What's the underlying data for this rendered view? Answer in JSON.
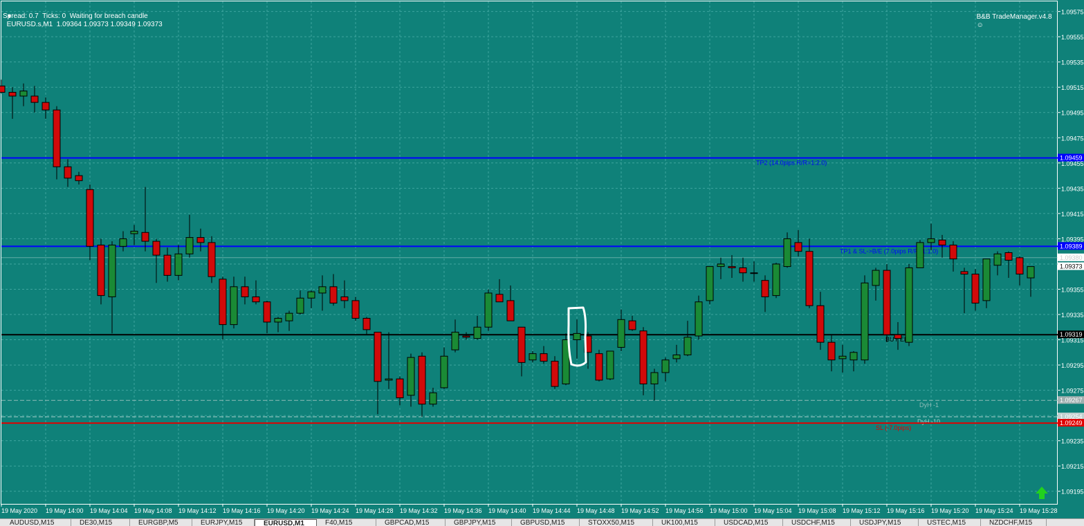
{
  "header": {
    "symbol_line": "EURUSD.s,M1  1.09364 1.09373 1.09349 1.09373",
    "status_line": "Spread: 0.7  Ticks: 0  Waiting for breach candle",
    "manager_label": "B&B TradeManager.v4.8"
  },
  "colors": {
    "background": "#0f8179",
    "grid": "#3fa59e",
    "bull": "#1a8a35",
    "bear": "#d10a0a",
    "tp_line": "#0000ff",
    "entry_line": "#000000",
    "sl_line": "#e00000",
    "text": "#ffffff"
  },
  "price_axis": {
    "ticks": [
      "1.09575",
      "1.09555",
      "1.09535",
      "1.09515",
      "1.09495",
      "1.09475",
      "1.09455",
      "1.09435",
      "1.09415",
      "1.09395",
      "1.09375",
      "1.09355",
      "1.09335",
      "1.09315",
      "1.09295",
      "1.09275",
      "1.09255",
      "1.09235",
      "1.09215",
      "1.09195"
    ],
    "labels": [
      {
        "text": "1.09459",
        "price": 1.09459,
        "color": "#0000ff",
        "fg": "#ffffff"
      },
      {
        "text": "1.09389",
        "price": 1.09389,
        "color": "#0000ff",
        "fg": "#ffffff"
      },
      {
        "text": "1.09380",
        "price": 1.0938,
        "color": "#ffffff",
        "fg": "#cccccc"
      },
      {
        "text": "1.09373",
        "price": 1.09373,
        "color": "#ffffff",
        "fg": "#000000"
      },
      {
        "text": "1.09319",
        "price": 1.09319,
        "color": "#000000",
        "fg": "#ffffff"
      },
      {
        "text": "1.09267",
        "price": 1.09267,
        "color": "#a0b0b0",
        "fg": "#ffffff"
      },
      {
        "text": "1.09254",
        "price": 1.09254,
        "color": "#c0d0d0",
        "fg": "#ffffff"
      },
      {
        "text": "1.09249",
        "price": 1.09249,
        "color": "#e00000",
        "fg": "#ffffff"
      }
    ]
  },
  "time_axis": {
    "labels": [
      "19 May 2020",
      "19 May 14:00",
      "19 May 14:04",
      "19 May 14:08",
      "19 May 14:12",
      "19 May 14:16",
      "19 May 14:20",
      "19 May 14:24",
      "19 May 14:28",
      "19 May 14:32",
      "19 May 14:36",
      "19 May 14:40",
      "19 May 14:44",
      "19 May 14:48",
      "19 May 14:52",
      "19 May 14:56",
      "19 May 15:00",
      "19 May 15:04",
      "19 May 15:08",
      "19 May 15:12",
      "19 May 15:16",
      "19 May 15:20",
      "19 May 15:24",
      "19 May 15:28"
    ]
  },
  "levels": [
    {
      "name": "tp2-line",
      "price": 1.09459,
      "color": "#0000ff",
      "label": "TP2 (14.0pips R/R=1:2.0)",
      "label_x": 1093,
      "dash": false,
      "width": 2
    },
    {
      "name": "tp1-line",
      "price": 1.09389,
      "color": "#0000ff",
      "label": "TP1 & SL->B/E (7.0pips R/R=1:1.0)",
      "label_x": 1214,
      "dash": false,
      "width": 2
    },
    {
      "name": "entry-line",
      "price": 1.09319,
      "color": "#000000",
      "label": "BUY EP",
      "label_x": 1280,
      "dash": false,
      "width": 2
    },
    {
      "name": "dyh1-line",
      "price": 1.09267,
      "color": "#8fbcb8",
      "label": "DyH -1",
      "label_x": 1329,
      "dash": true,
      "width": 1
    },
    {
      "name": "dyh10-line",
      "price": 1.09254,
      "color": "#a8cfcb",
      "label": "DyH -10",
      "label_x": 1326,
      "dash": true,
      "width": 1
    },
    {
      "name": "sl-line",
      "price": 1.09249,
      "color": "#e00000",
      "label": "SL (-7.0pips)",
      "label_x": 1266,
      "dash": false,
      "width": 2
    }
  ],
  "chart_data": {
    "type": "candlestick",
    "symbol": "EURUSD.s",
    "timeframe": "M1",
    "ylim": [
      1.09185,
      1.09583
    ],
    "candles": [
      {
        "o": 1.09516,
        "h": 1.09521,
        "l": 1.0951,
        "c": 1.09511
      },
      {
        "o": 1.09511,
        "h": 1.09515,
        "l": 1.0949,
        "c": 1.09508
      },
      {
        "o": 1.09508,
        "h": 1.09518,
        "l": 1.095,
        "c": 1.09512
      },
      {
        "o": 1.09508,
        "h": 1.09516,
        "l": 1.09495,
        "c": 1.09503
      },
      {
        "o": 1.09503,
        "h": 1.09507,
        "l": 1.0949,
        "c": 1.09497
      },
      {
        "o": 1.09497,
        "h": 1.095,
        "l": 1.09442,
        "c": 1.09452
      },
      {
        "o": 1.09452,
        "h": 1.09458,
        "l": 1.09436,
        "c": 1.09443
      },
      {
        "o": 1.09445,
        "h": 1.09448,
        "l": 1.09438,
        "c": 1.09441
      },
      {
        "o": 1.09434,
        "h": 1.09438,
        "l": 1.09378,
        "c": 1.09389
      },
      {
        "o": 1.0939,
        "h": 1.09395,
        "l": 1.09343,
        "c": 1.0935
      },
      {
        "o": 1.09349,
        "h": 1.09393,
        "l": 1.0932,
        "c": 1.0939
      },
      {
        "o": 1.09389,
        "h": 1.09401,
        "l": 1.09385,
        "c": 1.09395
      },
      {
        "o": 1.09399,
        "h": 1.09406,
        "l": 1.0939,
        "c": 1.09401
      },
      {
        "o": 1.094,
        "h": 1.09436,
        "l": 1.09385,
        "c": 1.09393
      },
      {
        "o": 1.09393,
        "h": 1.09395,
        "l": 1.0936,
        "c": 1.09382
      },
      {
        "o": 1.09382,
        "h": 1.09388,
        "l": 1.09361,
        "c": 1.09366
      },
      {
        "o": 1.09366,
        "h": 1.0939,
        "l": 1.09362,
        "c": 1.09383
      },
      {
        "o": 1.09383,
        "h": 1.09414,
        "l": 1.0938,
        "c": 1.09396
      },
      {
        "o": 1.09396,
        "h": 1.09403,
        "l": 1.09385,
        "c": 1.09392
      },
      {
        "o": 1.09392,
        "h": 1.09397,
        "l": 1.0936,
        "c": 1.09365
      },
      {
        "o": 1.09363,
        "h": 1.09365,
        "l": 1.09315,
        "c": 1.09327
      },
      {
        "o": 1.09327,
        "h": 1.09365,
        "l": 1.09324,
        "c": 1.09357
      },
      {
        "o": 1.09357,
        "h": 1.09365,
        "l": 1.09343,
        "c": 1.09349
      },
      {
        "o": 1.09349,
        "h": 1.09362,
        "l": 1.09343,
        "c": 1.09345
      },
      {
        "o": 1.09345,
        "h": 1.09346,
        "l": 1.0932,
        "c": 1.09329
      },
      {
        "o": 1.09329,
        "h": 1.09333,
        "l": 1.09321,
        "c": 1.09332
      },
      {
        "o": 1.0933,
        "h": 1.09338,
        "l": 1.09322,
        "c": 1.09336
      },
      {
        "o": 1.09336,
        "h": 1.09354,
        "l": 1.09335,
        "c": 1.09348
      },
      {
        "o": 1.09348,
        "h": 1.09354,
        "l": 1.0934,
        "c": 1.09353
      },
      {
        "o": 1.09352,
        "h": 1.09366,
        "l": 1.09338,
        "c": 1.09357
      },
      {
        "o": 1.09357,
        "h": 1.09367,
        "l": 1.09342,
        "c": 1.09344
      },
      {
        "o": 1.09349,
        "h": 1.09362,
        "l": 1.0934,
        "c": 1.09346
      },
      {
        "o": 1.09346,
        "h": 1.09349,
        "l": 1.0933,
        "c": 1.09332
      },
      {
        "o": 1.09332,
        "h": 1.09333,
        "l": 1.09319,
        "c": 1.09323
      },
      {
        "o": 1.09321,
        "h": 1.09321,
        "l": 1.09256,
        "c": 1.09282
      },
      {
        "o": 1.09283,
        "h": 1.09321,
        "l": 1.09276,
        "c": 1.09284
      },
      {
        "o": 1.09284,
        "h": 1.09286,
        "l": 1.09263,
        "c": 1.09269
      },
      {
        "o": 1.09271,
        "h": 1.09304,
        "l": 1.09262,
        "c": 1.09301
      },
      {
        "o": 1.09302,
        "h": 1.09305,
        "l": 1.09254,
        "c": 1.09264
      },
      {
        "o": 1.09264,
        "h": 1.09277,
        "l": 1.09262,
        "c": 1.09273
      },
      {
        "o": 1.09277,
        "h": 1.09309,
        "l": 1.09276,
        "c": 1.09302
      },
      {
        "o": 1.09307,
        "h": 1.09331,
        "l": 1.09305,
        "c": 1.09321
      },
      {
        "o": 1.09318,
        "h": 1.09321,
        "l": 1.09315,
        "c": 1.09317
      },
      {
        "o": 1.09316,
        "h": 1.09334,
        "l": 1.09315,
        "c": 1.09325
      },
      {
        "o": 1.09325,
        "h": 1.09355,
        "l": 1.09322,
        "c": 1.09352
      },
      {
        "o": 1.09351,
        "h": 1.09363,
        "l": 1.09345,
        "c": 1.09345
      },
      {
        "o": 1.09346,
        "h": 1.09358,
        "l": 1.0933,
        "c": 1.0933
      },
      {
        "o": 1.09325,
        "h": 1.09325,
        "l": 1.09286,
        "c": 1.09297
      },
      {
        "o": 1.09299,
        "h": 1.09306,
        "l": 1.09297,
        "c": 1.09304
      },
      {
        "o": 1.09304,
        "h": 1.0931,
        "l": 1.09296,
        "c": 1.09298
      },
      {
        "o": 1.09298,
        "h": 1.09302,
        "l": 1.09276,
        "c": 1.09278
      },
      {
        "o": 1.0928,
        "h": 1.0932,
        "l": 1.09279,
        "c": 1.09315
      },
      {
        "o": 1.09315,
        "h": 1.09331,
        "l": 1.093,
        "c": 1.0932
      },
      {
        "o": 1.09318,
        "h": 1.09321,
        "l": 1.09292,
        "c": 1.09305
      },
      {
        "o": 1.09304,
        "h": 1.09307,
        "l": 1.09282,
        "c": 1.09283
      },
      {
        "o": 1.09284,
        "h": 1.09305,
        "l": 1.09283,
        "c": 1.09306
      },
      {
        "o": 1.09309,
        "h": 1.09339,
        "l": 1.09306,
        "c": 1.09331
      },
      {
        "o": 1.0933,
        "h": 1.09334,
        "l": 1.09322,
        "c": 1.09323
      },
      {
        "o": 1.09322,
        "h": 1.09325,
        "l": 1.09271,
        "c": 1.0928
      },
      {
        "o": 1.0928,
        "h": 1.09292,
        "l": 1.09267,
        "c": 1.09289
      },
      {
        "o": 1.09289,
        "h": 1.09301,
        "l": 1.09282,
        "c": 1.09299
      },
      {
        "o": 1.093,
        "h": 1.09311,
        "l": 1.09297,
        "c": 1.09303
      },
      {
        "o": 1.09303,
        "h": 1.0933,
        "l": 1.09302,
        "c": 1.09317
      },
      {
        "o": 1.09318,
        "h": 1.0935,
        "l": 1.09315,
        "c": 1.09345
      },
      {
        "o": 1.09346,
        "h": 1.09369,
        "l": 1.09343,
        "c": 1.09373
      },
      {
        "o": 1.09373,
        "h": 1.0938,
        "l": 1.09363,
        "c": 1.09375
      },
      {
        "o": 1.09373,
        "h": 1.09382,
        "l": 1.09364,
        "c": 1.09372
      },
      {
        "o": 1.09372,
        "h": 1.0938,
        "l": 1.09361,
        "c": 1.09368
      },
      {
        "o": 1.09368,
        "h": 1.09377,
        "l": 1.09361,
        "c": 1.09368
      },
      {
        "o": 1.09362,
        "h": 1.09366,
        "l": 1.09337,
        "c": 1.09349
      },
      {
        "o": 1.0935,
        "h": 1.09376,
        "l": 1.09348,
        "c": 1.09375
      },
      {
        "o": 1.09373,
        "h": 1.094,
        "l": 1.09372,
        "c": 1.09395
      },
      {
        "o": 1.09392,
        "h": 1.09402,
        "l": 1.09381,
        "c": 1.09385
      },
      {
        "o": 1.09385,
        "h": 1.09395,
        "l": 1.0934,
        "c": 1.09342
      },
      {
        "o": 1.09342,
        "h": 1.09353,
        "l": 1.09307,
        "c": 1.09313
      },
      {
        "o": 1.09313,
        "h": 1.09319,
        "l": 1.0929,
        "c": 1.09299
      },
      {
        "o": 1.093,
        "h": 1.09311,
        "l": 1.09289,
        "c": 1.09302
      },
      {
        "o": 1.09299,
        "h": 1.09306,
        "l": 1.0929,
        "c": 1.09305
      },
      {
        "o": 1.09299,
        "h": 1.09366,
        "l": 1.09296,
        "c": 1.0936
      },
      {
        "o": 1.09358,
        "h": 1.09372,
        "l": 1.09346,
        "c": 1.0937
      },
      {
        "o": 1.0937,
        "h": 1.09375,
        "l": 1.09313,
        "c": 1.09319
      },
      {
        "o": 1.09319,
        "h": 1.09329,
        "l": 1.09307,
        "c": 1.09316
      },
      {
        "o": 1.09313,
        "h": 1.09375,
        "l": 1.0931,
        "c": 1.09372
      },
      {
        "o": 1.09372,
        "h": 1.09394,
        "l": 1.09372,
        "c": 1.09392
      },
      {
        "o": 1.09392,
        "h": 1.09407,
        "l": 1.09386,
        "c": 1.09395
      },
      {
        "o": 1.09394,
        "h": 1.09398,
        "l": 1.0938,
        "c": 1.0939
      },
      {
        "o": 1.0939,
        "h": 1.09393,
        "l": 1.09369,
        "c": 1.09379
      },
      {
        "o": 1.09369,
        "h": 1.09372,
        "l": 1.09336,
        "c": 1.09367
      },
      {
        "o": 1.09367,
        "h": 1.09371,
        "l": 1.09338,
        "c": 1.09344
      },
      {
        "o": 1.09346,
        "h": 1.09379,
        "l": 1.0934,
        "c": 1.09379
      },
      {
        "o": 1.09374,
        "h": 1.09385,
        "l": 1.09366,
        "c": 1.09383
      },
      {
        "o": 1.09384,
        "h": 1.09385,
        "l": 1.09364,
        "c": 1.09378
      },
      {
        "o": 1.0938,
        "h": 1.09381,
        "l": 1.09358,
        "c": 1.09367
      },
      {
        "o": 1.09364,
        "h": 1.09373,
        "l": 1.09349,
        "c": 1.09373
      }
    ]
  },
  "tabs": [
    "AUDUSD,M15",
    "DE30,M15",
    "EURGBP,M5",
    "EURJPY,M15",
    "EURUSD,M1",
    "F40,M15",
    "GBPCAD,M15",
    "GBPJPY,M15",
    "GBPUSD,M15",
    "STOXX50,M15",
    "UK100,M15",
    "USDCAD,M15",
    "USDCHF,M15",
    "USDJPY,M15",
    "USTEC,M15",
    "NZDCHF,M15"
  ],
  "active_tab": "EURUSD,M1"
}
